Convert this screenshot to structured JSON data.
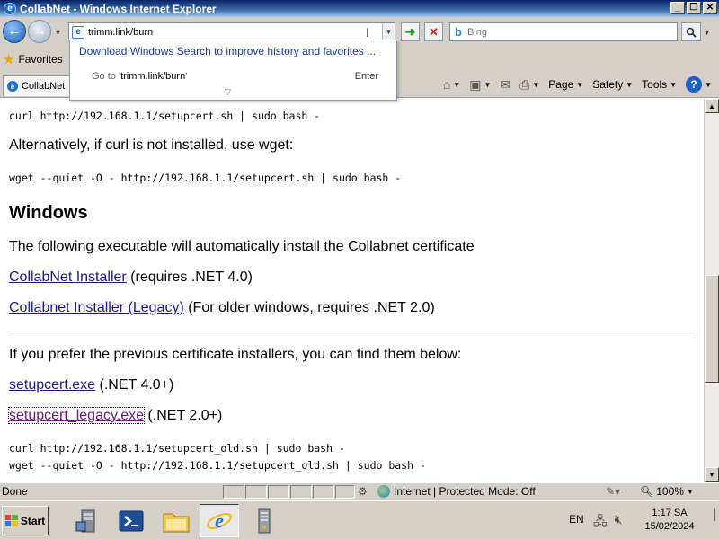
{
  "window": {
    "title": "CollabNet - Windows Internet Explorer",
    "controls": [
      "_",
      "❐",
      "✕"
    ]
  },
  "nav": {
    "address_url": "trimm.link/burn",
    "search_placeholder": "Bing"
  },
  "autocomplete": {
    "promo": "Download Windows Search to improve history and favorites ...",
    "goto_prefix": "Go to '",
    "goto_url": "trimm.link/burn",
    "goto_suffix": "'",
    "enter_label": "Enter"
  },
  "favorites": {
    "label": "Favorites"
  },
  "tab": {
    "label": "CollabNet"
  },
  "commands": {
    "page": "Page",
    "safety": "Safety",
    "tools": "Tools"
  },
  "content": {
    "curl_cmd": "curl http://192.168.1.1/setupcert.sh | sudo bash -",
    "alt_text": "Alternatively, if curl is not installed, use wget:",
    "wget_cmd": "wget --quiet -O - http://192.168.1.1/setupcert.sh | sudo bash -",
    "windows_heading": "Windows",
    "executable_text": "The following executable will automatically install the Collabnet certificate",
    "installer_link": "CollabNet Installer",
    "installer_note": " (requires .NET 4.0)",
    "legacy_link": "Collabnet Installer (Legacy)",
    "legacy_note": " (For older windows, requires .NET 2.0)",
    "prev_text": "If you prefer the previous certificate installers, you can find them below:",
    "setupcert_link": "setupcert.exe",
    "setupcert_note": " (.NET 4.0+)",
    "setupcert_legacy_link": "setupcert_legacy.exe",
    "setupcert_legacy_note": " (.NET 2.0+)",
    "curl_old_cmd": "curl http://192.168.1.1/setupcert_old.sh | sudo bash -",
    "wget_old_cmd": "wget --quiet -O - http://192.168.1.1/setupcert_old.sh | sudo bash -"
  },
  "status": {
    "text": "Done",
    "zone": "Internet | Protected Mode: Off",
    "zoom": "100%"
  },
  "taskbar": {
    "start": "Start",
    "language": "EN",
    "time": "1:17 SA",
    "date": "15/02/2024"
  }
}
